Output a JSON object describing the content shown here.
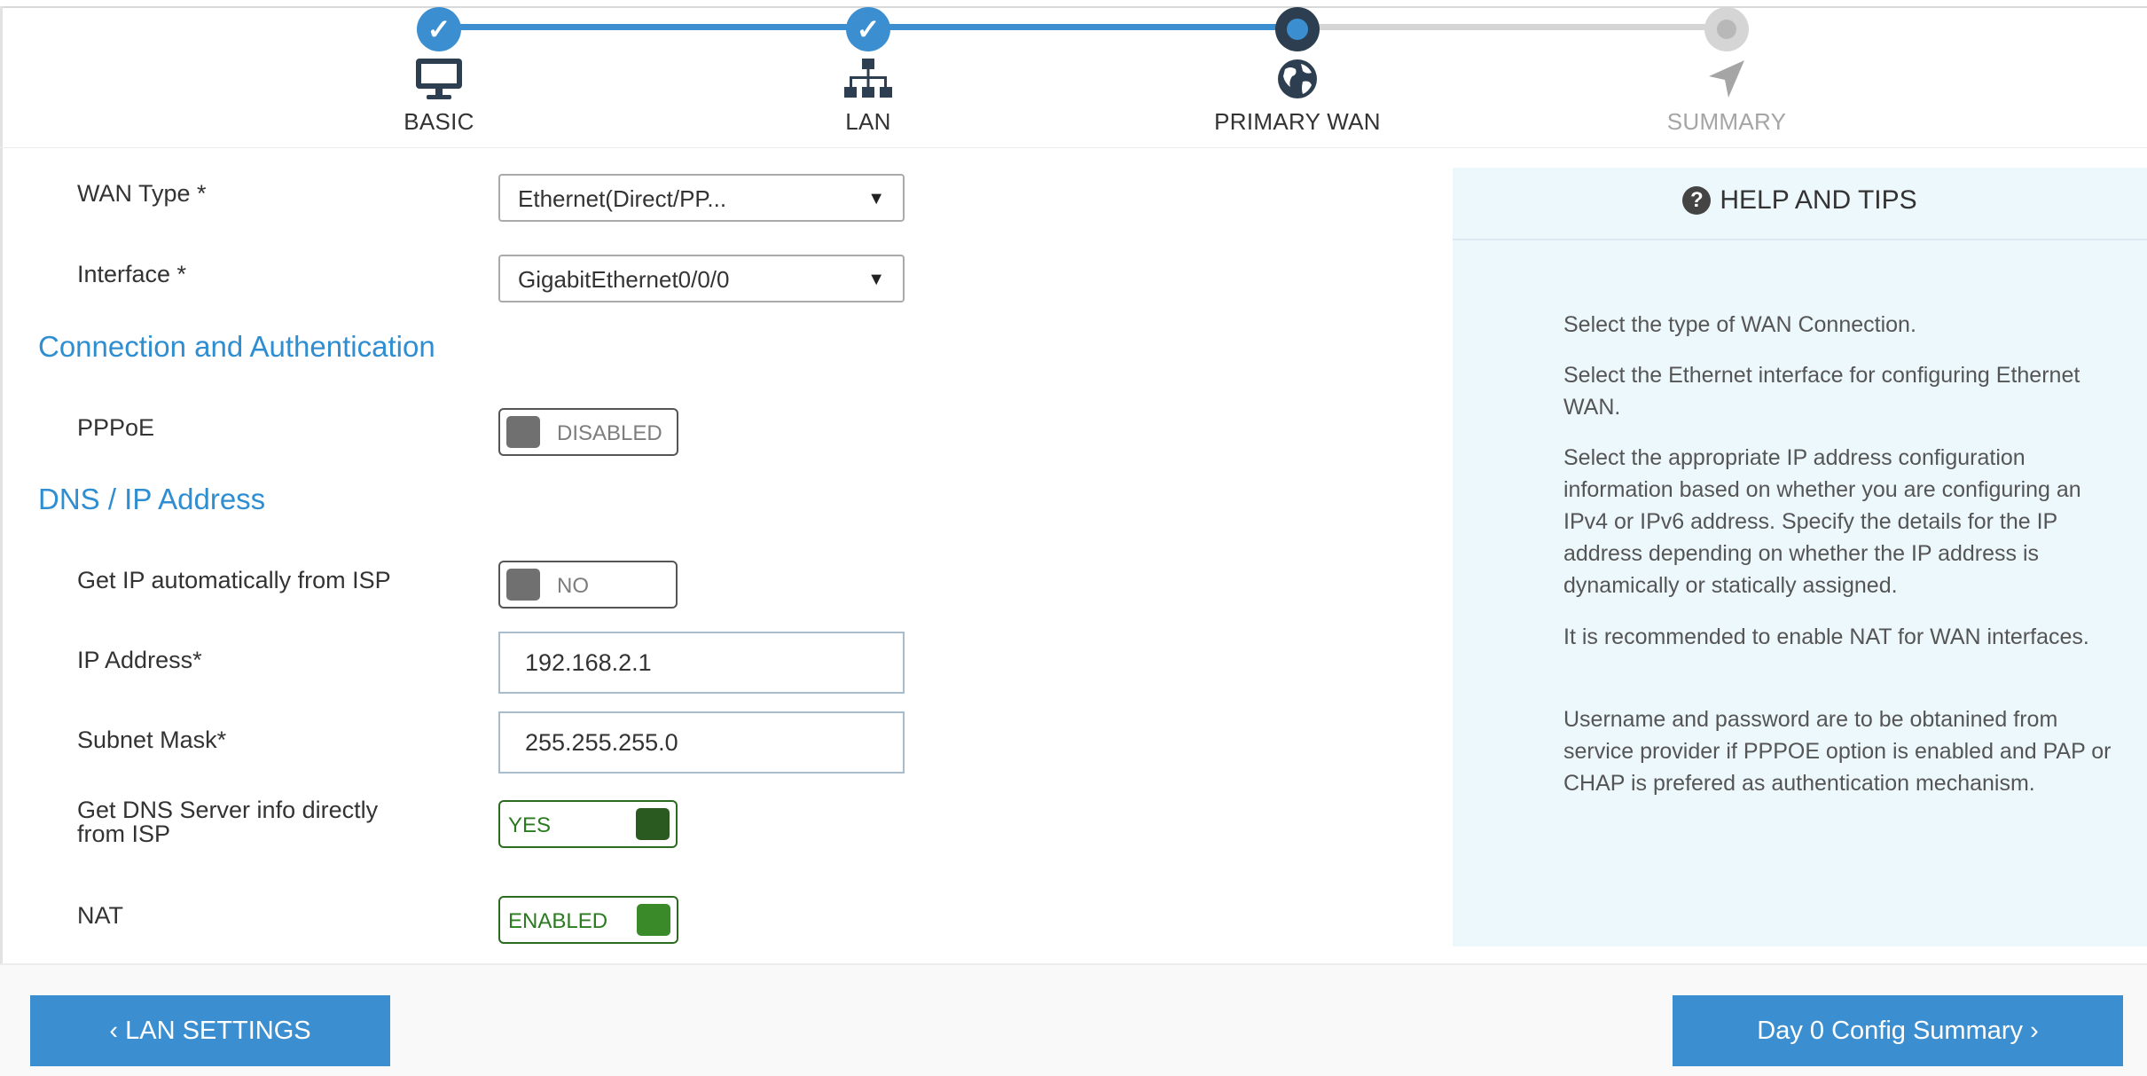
{
  "wizard": {
    "steps": [
      {
        "label": "BASIC",
        "state": "done",
        "icon": "monitor-icon",
        "check": "✓"
      },
      {
        "label": "LAN",
        "state": "done",
        "icon": "network-icon",
        "check": "✓"
      },
      {
        "label": "PRIMARY WAN",
        "state": "active",
        "icon": "globe-icon"
      },
      {
        "label": "SUMMARY",
        "state": "todo",
        "icon": "navigation-arrow-icon"
      }
    ],
    "colors": {
      "done": "#3b8fd0",
      "active": "#2c3e4f",
      "todo": "#d5d5d5"
    }
  },
  "form": {
    "wan_type": {
      "label": "WAN Type *",
      "value": "Ethernet(Direct/PP..."
    },
    "interface": {
      "label": "Interface *",
      "value": "GigabitEthernet0/0/0"
    },
    "section_connection": "Connection and Authentication",
    "pppoe": {
      "label": "PPPoE",
      "state_text": "DISABLED",
      "on": false
    },
    "section_dns": "DNS / IP Address",
    "get_ip_auto": {
      "label": "Get IP automatically from ISP",
      "state_text": "NO",
      "on": false
    },
    "ip_address": {
      "label": "IP Address*",
      "value": "192.168.2.1"
    },
    "subnet_mask": {
      "label": "Subnet Mask*",
      "value": "255.255.255.0"
    },
    "dns_from_isp": {
      "label_line1": "Get DNS Server info directly",
      "label_line2": "from ISP",
      "state_text": "YES",
      "on": true,
      "knob_color": "#2a5a1f"
    },
    "nat": {
      "label": "NAT",
      "state_text": "ENABLED",
      "on": true,
      "knob_color": "#3b8a2a"
    }
  },
  "help": {
    "title": "HELP AND TIPS",
    "icon": "question-circle-icon",
    "icon_glyph": "?",
    "tips": [
      "Select the type of WAN Connection.",
      "Select the Ethernet interface for configuring Ethernet WAN.",
      "Select the appropriate IP address configuration information based on whether you are configuring an IPv4 or IPv6 address. Specify the details for the IP address depending on whether the IP address is dynamically or statically assigned.",
      "It is recommended to enable NAT for WAN interfaces.",
      "Username and password are to be obtanined from service provider if PPPOE option is enabled and PAP or CHAP is prefered as authentication mechanism."
    ]
  },
  "footer": {
    "back_button": "‹ LAN SETTINGS",
    "next_button": "Day 0 Config Summary ›"
  },
  "colors": {
    "accent": "#3b8fd0",
    "section": "#2f8ed1",
    "help_bg": "#edf8fd",
    "toggle_on_border": "#2a6b1f"
  }
}
